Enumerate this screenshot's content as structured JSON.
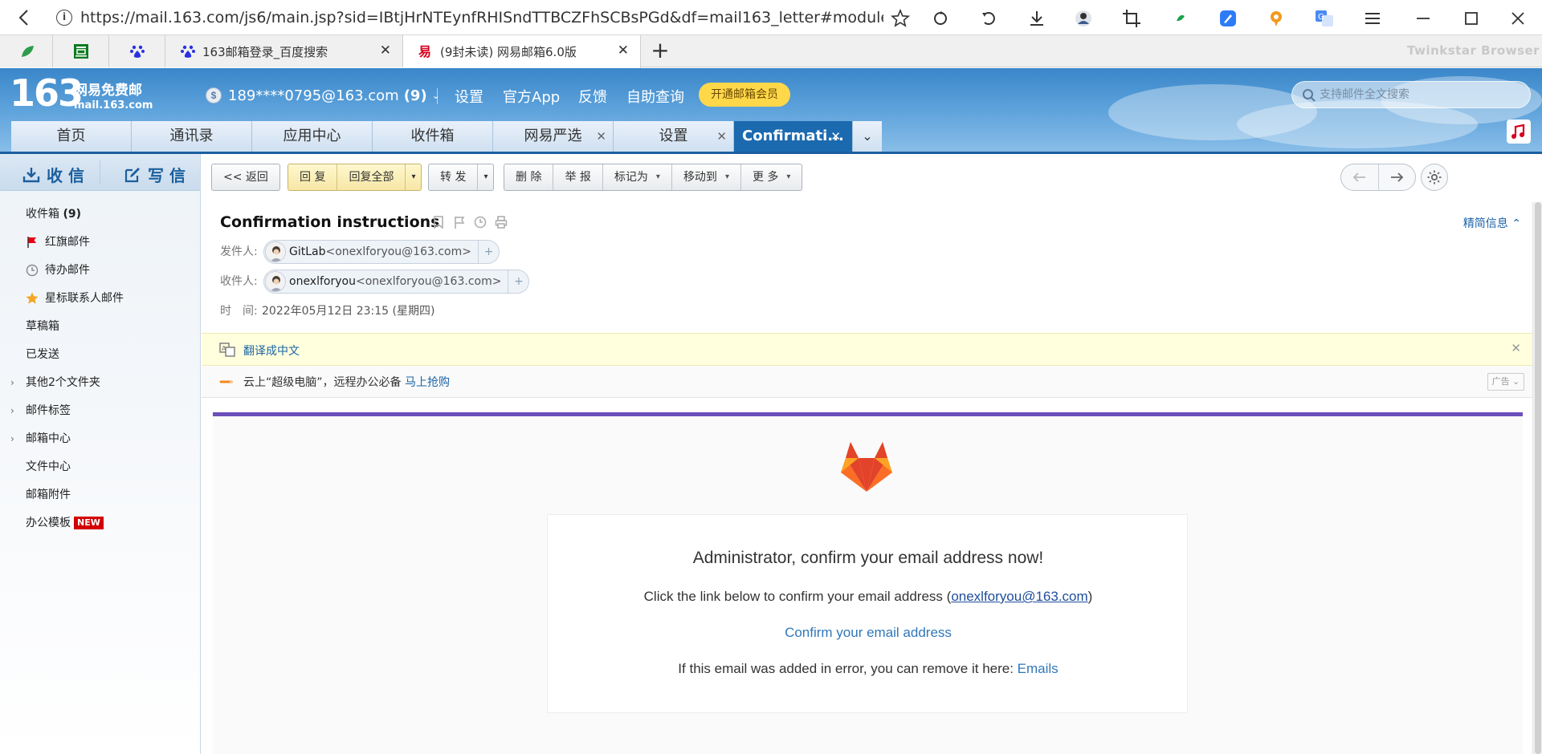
{
  "browser": {
    "url": "https://mail.163.com/js6/main.jsp?sid=IBtjHrNTEynfRHISndTTBCZFhSCBsPGd&df=mail163_letter#module=read.Read...",
    "brand": "Twinkstar Browser",
    "tabs": [
      {
        "label": "",
        "icon": "leaf-icon"
      },
      {
        "label": "",
        "icon": "douban-icon"
      },
      {
        "label": "",
        "icon": "baidu-paw-icon"
      },
      {
        "label": "163邮箱登录_百度搜索",
        "icon": "baidu-paw-icon"
      },
      {
        "label": "(9封未读) 网易邮箱6.0版",
        "icon": "netease-mail-icon",
        "active": true
      }
    ],
    "new_tab": "+"
  },
  "mail_header": {
    "logo_number": "163",
    "logo_name": "网易免费邮",
    "logo_domain": "mail.163.com",
    "account": "189****0795@163.com",
    "unread": "(9)",
    "links": [
      "设置",
      "官方App",
      "反馈",
      "自助查询"
    ],
    "vip_button": "开通邮箱会员",
    "search_placeholder": "支持邮件全文搜索",
    "module_tabs": [
      {
        "label": "首页"
      },
      {
        "label": "通讯录"
      },
      {
        "label": "应用中心"
      },
      {
        "label": "收件箱"
      },
      {
        "label": "网易严选",
        "closable": true
      },
      {
        "label": "设置",
        "closable": true
      },
      {
        "label": "Confirmati...",
        "closable": true,
        "active": true
      }
    ]
  },
  "sidebar": {
    "receive": "收 信",
    "compose": "写 信",
    "inbox_label": "收件箱",
    "inbox_count": "(9)",
    "flagged": "红旗邮件",
    "todo": "待办邮件",
    "starred": "星标联系人邮件",
    "drafts": "草稿箱",
    "sent": "已发送",
    "other_folders": "其他2个文件夹",
    "mail_tags": "邮件标签",
    "mail_center": "邮箱中心",
    "file_center": "文件中心",
    "attachments": "邮箱附件",
    "templates": "办公模板",
    "new_badge": "NEW"
  },
  "toolbar": {
    "back": "<< 返回",
    "reply": "回 复",
    "reply_all": "回复全部",
    "forward": "转 发",
    "delete": "删 除",
    "report": "举 报",
    "mark_as": "标记为",
    "move_to": "移动到",
    "more": "更 多"
  },
  "message": {
    "subject": "Confirmation instructions",
    "brief_info": "精简信息",
    "from_label": "发件人:",
    "from_name": "GitLab",
    "from_addr": "<onexlforyou@163.com>",
    "to_label": "收件人:",
    "to_name": "onexlforyou",
    "to_addr": "<onexlforyou@163.com>",
    "time_label": "时　间:",
    "time_value": "2022年05月12日 23:15 (星期四)",
    "translate": "翻译成中文",
    "ad_text": "云上“超级电脑”，远程办公必备",
    "ad_link": "马上抢购",
    "ad_tag": "广告",
    "body": {
      "heading": "Administrator, confirm your email address now!",
      "line1_pre": "Click the link below to confirm your email address (",
      "line1_link": "onexlforyou@163.com",
      "line1_post": ")",
      "confirm_link": "Confirm your email address",
      "line3_pre": "If this email was added in error, you can remove it here: ",
      "line3_link": "Emails"
    }
  },
  "colors": {
    "header_blue": "#3a86c9",
    "active_tab": "#1b6ab0",
    "gitlab_purple": "#6b4fbb",
    "link_blue": "#1b64a6",
    "vip_yellow": "#ffd84a"
  }
}
